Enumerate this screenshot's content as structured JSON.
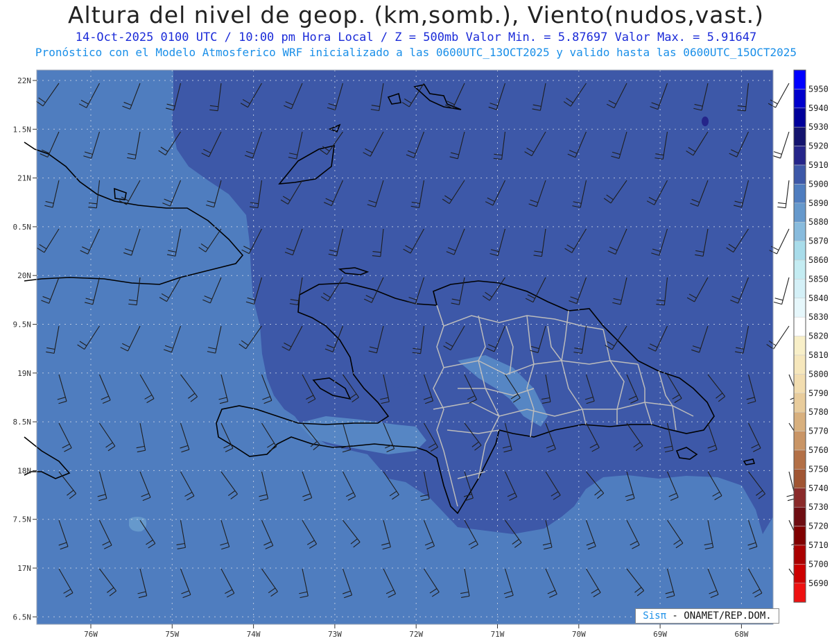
{
  "header": {
    "title": "Altura del nivel de geop. (km,somb.), Viento(nudos,vast.)",
    "subtitle": "14-Oct-2025  0100 UTC / 10:00 pm Hora Local / Z = 500mb   Valor Min. = 5.87697  Valor Max. = 5.91647",
    "model_line": "Pronóstico con el Modelo Atmosferico WRF inicializado a las 0600UTC_13OCT2025 y valido hasta las  0600UTC_15OCT2025"
  },
  "map": {
    "lat_labels": [
      "22N",
      "1.5N",
      "21N",
      "0.5N",
      "20N",
      "9.5N",
      "19N",
      "8.5N",
      "18N",
      "7.5N",
      "17N",
      "6.5N"
    ],
    "lon_labels": [
      "76W",
      "75W",
      "74W",
      "73W",
      "72W",
      "71W",
      "70W",
      "69W",
      "68W"
    ],
    "ocean_color": "#4f7dbf",
    "high_color": "#3d58a8",
    "mid_color": "#5a8ec9"
  },
  "legend": {
    "levels": [
      "5950",
      "5940",
      "5930",
      "5920",
      "5910",
      "5900",
      "5890",
      "5880",
      "5870",
      "5860",
      "5850",
      "5840",
      "5830",
      "5820",
      "5810",
      "5800",
      "5790",
      "5780",
      "5770",
      "5760",
      "5750",
      "5740",
      "5730",
      "5720",
      "5710",
      "5700",
      "5690"
    ],
    "colors": [
      "#0000ff",
      "#0000cc",
      "#00009a",
      "#14146e",
      "#25258a",
      "#3d58a8",
      "#4f7dbf",
      "#6699cc",
      "#88bbdd",
      "#a8dcea",
      "#c4ecf2",
      "#d4f0f7",
      "#e6f7fb",
      "#ffffff",
      "#f8efc8",
      "#f6e7bc",
      "#f2ddb0",
      "#e8cc9c",
      "#d8b07e",
      "#c99566",
      "#b37047",
      "#a05533",
      "#8a2a2a",
      "#6e0d12",
      "#800000",
      "#aa0000",
      "#cc0000",
      "#ee1111"
    ]
  },
  "credit": {
    "brand": "SisTT",
    "text": " - ONAMET/REP.DOM."
  }
}
